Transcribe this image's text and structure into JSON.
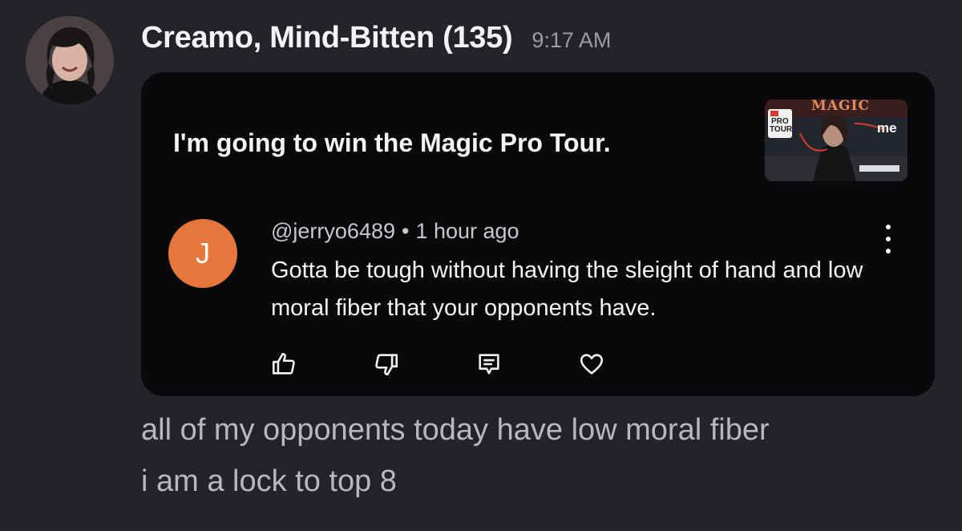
{
  "message": {
    "author": "Creamo, Mind-Bitten (135)",
    "timestamp": "9:17 AM",
    "lines": [
      "all of my opponents today have low moral fiber",
      "i am a lock to top 8"
    ]
  },
  "embed": {
    "title": "I'm going to win the Magic Pro Tour.",
    "thumbnail": {
      "logo_text": "MAGIC",
      "badge_line1": "PRO",
      "badge_line2": "TOUR",
      "annotation": "me"
    },
    "comment": {
      "avatar_letter": "J",
      "username": "@jerryo6489",
      "separator": "•",
      "time": "1 hour ago",
      "text": "Gotta be tough without having the sleight of hand and low moral fiber that your opponents have."
    },
    "actions": [
      "thumbs-up-icon",
      "thumbs-down-icon",
      "comment-icon",
      "heart-icon"
    ]
  },
  "colors": {
    "background": "#232329",
    "embed_background": "#09090b",
    "comment_avatar": "#e5773d"
  }
}
